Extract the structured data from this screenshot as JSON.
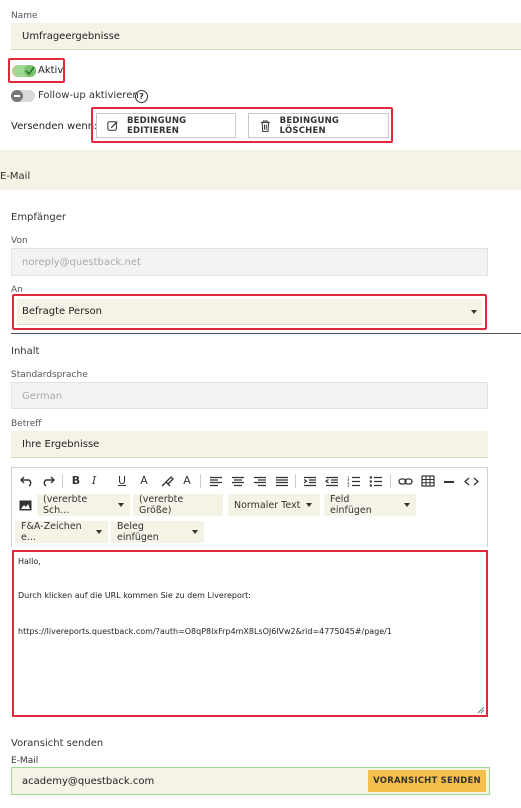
{
  "form": {
    "name_label": "Name",
    "name_value": "Umfrageergebnisse",
    "active_label": "Aktiv",
    "followup_label": "Follow-up aktivieren",
    "help_symbol": "?",
    "send_when_label": "Versenden wenn:",
    "edit_condition": "BEDINGUNG EDITIEREN",
    "delete_condition": "BEDINGUNG LÖSCHEN"
  },
  "email": {
    "section_title": "E-Mail",
    "recipient_heading": "Empfänger",
    "from_label": "Von",
    "from_value": "noreply@questback.net",
    "to_label": "An",
    "to_value": "Befragte Person",
    "content_heading": "Inhalt",
    "language_label": "Standardsprache",
    "language_value": "German",
    "subject_label": "Betreff",
    "subject_value": "Ihre Ergebnisse"
  },
  "toolbar": {
    "font_family": "(vererbte Sch...",
    "font_size": "(vererbte Größe)",
    "paragraph": "Normaler Text",
    "insert_field": "Feld einfügen",
    "qa_chars": "F&A-Zeichen e...",
    "insert_receipt": "Beleg einfügen"
  },
  "body": {
    "line1": "Hallo,",
    "line2": "Durch klicken auf die URL kommen Sie zu dem Livereport:",
    "line3": "https://livereports.questback.com/?auth=O8qP8lxFrp4mX8LsOJ6lVw2&rid=4775045#/page/1"
  },
  "preview": {
    "heading": "Voransicht senden",
    "email_label": "E-Mail",
    "email_value": "academy@questback.com",
    "send_button": "VORANSICHT SENDEN"
  },
  "colors": {
    "accent_green": "#7bc46f",
    "field_bg": "#f4f3e6",
    "highlight_red": "#e0293b",
    "button_yellow": "#f5c04a"
  }
}
